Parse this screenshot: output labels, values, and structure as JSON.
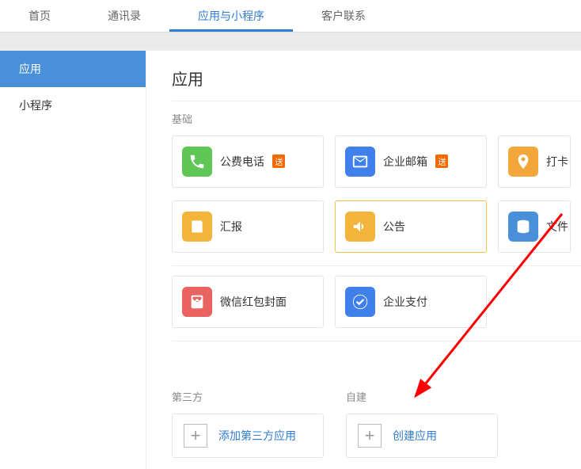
{
  "topnav": {
    "items": [
      {
        "label": "首页",
        "active": false
      },
      {
        "label": "通讯录",
        "active": false
      },
      {
        "label": "应用与小程序",
        "active": true
      },
      {
        "label": "客户联系",
        "active": false
      }
    ]
  },
  "sidebar": {
    "items": [
      {
        "label": "应用",
        "active": true
      },
      {
        "label": "小程序",
        "active": false
      }
    ]
  },
  "main": {
    "title": "应用",
    "sections": {
      "basic": {
        "title": "基础",
        "apps": {
          "phone": {
            "label": "公费电话",
            "tag": "送"
          },
          "mail": {
            "label": "企业邮箱",
            "tag": "送"
          },
          "checkin": {
            "label": "打卡"
          },
          "report": {
            "label": "汇报"
          },
          "announce": {
            "label": "公告"
          },
          "file": {
            "label": "文件"
          },
          "redpacket": {
            "label": "微信红包封面"
          },
          "pay": {
            "label": "企业支付"
          }
        }
      },
      "thirdparty": {
        "title": "第三方",
        "add_label": "添加第三方应用"
      },
      "selfbuild": {
        "title": "自建",
        "add_label": "创建应用"
      }
    }
  }
}
